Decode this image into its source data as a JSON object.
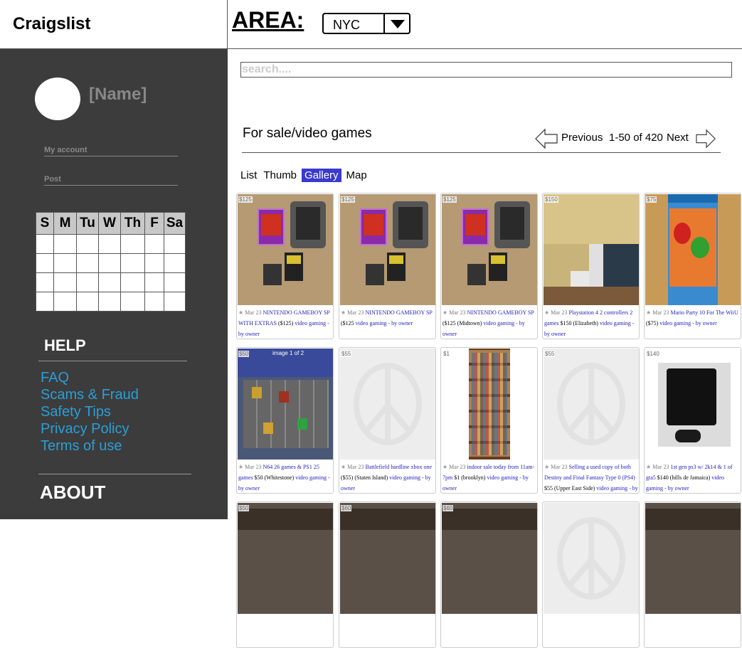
{
  "header": {
    "logo": "Craigslist",
    "area_label": "AREA:",
    "area_value": "NYC"
  },
  "sidebar": {
    "name": "[Name]",
    "links": [
      "My account",
      "Post"
    ],
    "calendar_days": [
      "S",
      "M",
      "Tu",
      "W",
      "Th",
      "F",
      "Sa"
    ],
    "help_title": "HELP",
    "help_links": [
      "FAQ",
      "Scams & Fraud",
      "Safety Tips",
      "Privacy Policy",
      "Terms of use"
    ],
    "about_title": "ABOUT"
  },
  "search": {
    "placeholder": "search...."
  },
  "listing": {
    "category": "For sale/video games",
    "prev_label": "Previous",
    "range": "1-50 of 420",
    "next_label": "Next",
    "views": [
      "List",
      "Thumb",
      "Gallery",
      "Map"
    ],
    "active_view": "Gallery"
  },
  "items": [
    {
      "price": "$125",
      "date": "Mar 23",
      "title": "NINTENDO GAMEBOY SP WITH EXTRAS",
      "meta": "($125)",
      "cat": "video gaming - by owner",
      "image": "gameboy"
    },
    {
      "price": "$125",
      "date": "Mar 23",
      "title": "NINTENDO GAMEBOY SP",
      "meta": "($125",
      "cat": "video gaming - by owner",
      "image": "gameboy"
    },
    {
      "price": "$125",
      "date": "Mar 23",
      "title": "NINTENDO GAMEBOY SP",
      "meta": "($125 (Midtown)",
      "cat": "video gaming - by owner",
      "image": "gameboy"
    },
    {
      "price": "$150",
      "date": "Mar 23",
      "title": "Playstation 4 2 controllers 2 games",
      "meta": "$150 (Elizabeth)",
      "cat": "video gaming - by owner",
      "image": "ps4"
    },
    {
      "price": "$75",
      "date": "Mar 23",
      "title": "Mario Party 10 For The WiiU",
      "meta": "($75)",
      "cat": "video gaming - by owner",
      "image": "mario"
    },
    {
      "price": "$50",
      "date": "Mar 23",
      "title": "N64 26 games & PS1 25 games",
      "meta": "$50 (Whitestone)",
      "cat": "video gaming - by owner",
      "image": "n64",
      "overlay": "image 1 of 2"
    },
    {
      "price": "$55",
      "date": "Mar 23",
      "title": "Battlefield hardline xbox one",
      "meta": "($55) (Staten Island)",
      "cat": "video gaming - by owner",
      "image": "none"
    },
    {
      "price": "$1",
      "date": "Mar 23",
      "title": "indoor sale today from 11am-7pm",
      "meta": "$1 (brooklyn)",
      "cat": "video gaming - by owner",
      "image": "shelves"
    },
    {
      "price": "$55",
      "date": "Mar 23",
      "title": "Selling a used copy of both Destiny and Final Fantasy Type 0 (PS4)",
      "meta": "$55 (Upper East Side)",
      "cat": "video gaming - by owner",
      "image": "none"
    },
    {
      "price": "$140",
      "date": "Mar 23",
      "title": "1st gen ps3 w/ 2k14 & 1 of gta5",
      "meta": "$140 (hills de Jamaica)",
      "cat": "video gaming - by owner",
      "image": "ps3"
    },
    {
      "price": "$50",
      "image": "dark"
    },
    {
      "price": "$60",
      "image": "dark"
    },
    {
      "price": "$60",
      "image": "dark"
    },
    {
      "price": "",
      "image": "none"
    },
    {
      "price": "",
      "image": "dark"
    }
  ],
  "colors": {
    "sidebar_bg": "#3c3c3c",
    "help_link": "#2a9ed8",
    "active_tab": "#3a3ad0",
    "item_link": "#2222bb"
  }
}
